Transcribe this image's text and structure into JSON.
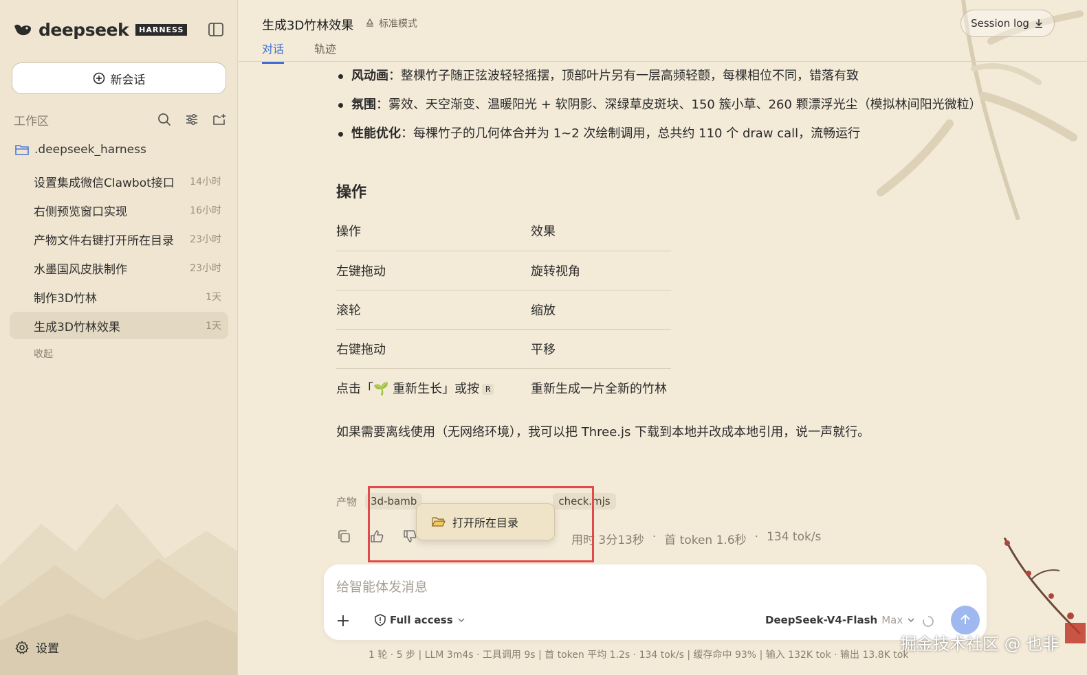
{
  "sidebar": {
    "brand": "deepseek",
    "badge": "HARNESS",
    "new_chat": "新会话",
    "workspace_title": "工作区",
    "folder": ".deepseek_harness",
    "sessions": [
      {
        "title": "设置集成微信Clawbot接口",
        "time": "14小时"
      },
      {
        "title": "右侧预览窗口实现",
        "time": "16小时"
      },
      {
        "title": "产物文件右键打开所在目录",
        "time": "23小时"
      },
      {
        "title": "水墨国风皮肤制作",
        "time": "23小时"
      },
      {
        "title": "制作3D竹林",
        "time": "1天"
      },
      {
        "title": "生成3D竹林效果",
        "time": "1天"
      }
    ],
    "collapse": "收起",
    "settings": "设置"
  },
  "header": {
    "title": "生成3D竹林效果",
    "mode": "标准模式",
    "tabs": [
      "对话",
      "轨迹"
    ],
    "session_log": "Session log"
  },
  "content": {
    "bullets": [
      {
        "label": "风动画",
        "text": "：整棵竹子随正弦波轻轻摇摆，顶部叶片另有一层高频轻颤，每棵相位不同，错落有致"
      },
      {
        "label": "氛围",
        "text": "：雾效、天空渐变、温暖阳光 + 软阴影、深绿草皮斑块、150 簇小草、260 颗漂浮光尘（模拟林间阳光微粒）"
      },
      {
        "label": "性能优化",
        "text": "：每棵竹子的几何体合并为 1~2 次绘制调用，总共约 110 个 draw call，流畅运行"
      }
    ],
    "section_title": "操作",
    "table": {
      "header": [
        "操作",
        "效果"
      ],
      "rows": [
        [
          "左键拖动",
          "旋转视角"
        ],
        [
          "滚轮",
          "缩放"
        ],
        [
          "右键拖动",
          "平移"
        ]
      ],
      "last_row": {
        "prefix": "点击「",
        "emoji": "🌱",
        "middle": " 重新生长」或按",
        "key": "R",
        "effect": "重新生成一片全新的竹林"
      }
    },
    "offline_note": "如果需要离线使用（无网络环境），我可以把 Three.js 下载到本地并改成本地引用，说一声就行。"
  },
  "artifacts": {
    "label": "产物",
    "files": [
      "3d-bamb",
      "check.mjs"
    ]
  },
  "context_menu": {
    "item": "打开所在目录"
  },
  "meta": {
    "duration": "用时 3分13秒",
    "first_token": "首 token 1.6秒",
    "speed": "134 tok/s"
  },
  "composer": {
    "placeholder": "给智能体发消息",
    "access": "Full access",
    "model": "DeepSeek-V4-Flash",
    "tier": "Max"
  },
  "footer": {
    "stats": "1 轮 · 5 步   |   LLM 3m4s · 工具调用 9s   |   首 token 平均 1.2s · 134 tok/s   |   缓存命中 93%   |   输入 132K tok · 输出 13.8K tok"
  },
  "watermark": "掘金技术社区 @ 也非",
  "colors": {
    "accent": "#3d6fd6",
    "highlight": "#e04a4a",
    "background": "#f3ead8",
    "sidebar": "#efe5d0"
  }
}
